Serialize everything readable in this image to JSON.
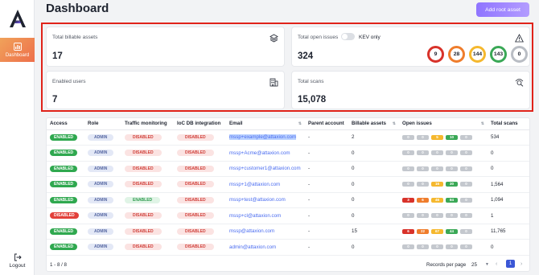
{
  "sidebar": {
    "nav_items": [
      {
        "label": "Dashboard",
        "icon": "dashboard-icon",
        "active": true
      }
    ],
    "logout_label": "Logout"
  },
  "header": {
    "title": "Dashboard",
    "add_button_label": "Add root asset"
  },
  "cards": {
    "billable": {
      "title": "Total billable assets",
      "value": "17",
      "icon": "layers-icon"
    },
    "issues": {
      "title": "Total open issues",
      "value": "324",
      "kev_label": "KEV only",
      "kev_enabled": false,
      "icon": "warning-icon",
      "rings": [
        {
          "value": "9",
          "color": "#d8322a"
        },
        {
          "value": "28",
          "color": "#ef7d2c"
        },
        {
          "value": "144",
          "color": "#f5b82e"
        },
        {
          "value": "143",
          "color": "#3aa856"
        },
        {
          "value": "0",
          "color": "#b9bdc4"
        }
      ]
    },
    "users": {
      "title": "Enabled users",
      "value": "7",
      "icon": "building-icon"
    },
    "scans": {
      "title": "Total scans",
      "value": "15,078",
      "icon": "radar-icon"
    }
  },
  "highlight_color": "#e0231a",
  "table": {
    "columns": [
      "Access",
      "Role",
      "Traffic monitoring",
      "IoC DB integration",
      "Email",
      "Parent account",
      "Billable assets",
      "Open issues",
      "Total scans"
    ],
    "issue_colors": [
      "#d8322a",
      "#ef7d2c",
      "#f5b82e",
      "#3aa856",
      "#c4c8ce"
    ],
    "rows": [
      {
        "access": "ENABLED",
        "role": "ADMIN",
        "traffic": "DISABLED",
        "ioc": "DISABLED",
        "email": "mssp+example@attaxion.com",
        "parent": "-",
        "billable": "2",
        "issues": [
          "0",
          "0",
          "5",
          "10",
          "0"
        ],
        "scans": "534"
      },
      {
        "access": "ENABLED",
        "role": "ADMIN",
        "traffic": "DISABLED",
        "ioc": "DISABLED",
        "email": "mssp+Acme@attaxion.com",
        "parent": "-",
        "billable": "0",
        "issues": [
          "0",
          "0",
          "0",
          "0",
          "0"
        ],
        "scans": "0"
      },
      {
        "access": "ENABLED",
        "role": "ADMIN",
        "traffic": "DISABLED",
        "ioc": "DISABLED",
        "email": "mssp+customer1@attaxion.com",
        "parent": "-",
        "billable": "0",
        "issues": [
          "0",
          "0",
          "0",
          "0",
          "0"
        ],
        "scans": "0"
      },
      {
        "access": "ENABLED",
        "role": "ADMIN",
        "traffic": "DISABLED",
        "ioc": "DISABLED",
        "email": "mssp+1@attaxion.com",
        "parent": "-",
        "billable": "0",
        "issues": [
          "0",
          "0",
          "16",
          "30",
          "0"
        ],
        "scans": "1,564"
      },
      {
        "access": "ENABLED",
        "role": "ADMIN",
        "traffic": "ENABLED",
        "ioc": "DISABLED",
        "email": "mssp+test@attaxion.com",
        "parent": "-",
        "billable": "0",
        "issues": [
          "3",
          "6",
          "46",
          "84",
          "0"
        ],
        "scans": "1,094"
      },
      {
        "access": "DISABLED",
        "role": "ADMIN",
        "traffic": "DISABLED",
        "ioc": "DISABLED",
        "email": "mssp+cl@attaxion.com",
        "parent": "-",
        "billable": "0",
        "issues": [
          "0",
          "0",
          "0",
          "0",
          "0"
        ],
        "scans": "1"
      },
      {
        "access": "ENABLED",
        "role": "ADMIN",
        "traffic": "DISABLED",
        "ioc": "DISABLED",
        "email": "mssp@attaxion.com",
        "parent": "-",
        "billable": "15",
        "issues": [
          "6",
          "22",
          "67",
          "44",
          "0"
        ],
        "scans": "11,765"
      },
      {
        "access": "ENABLED",
        "role": "ADMIN",
        "traffic": "DISABLED",
        "ioc": "DISABLED",
        "email": "admin@attaxion.com",
        "parent": "-",
        "billable": "0",
        "issues": [
          "0",
          "0",
          "0",
          "0",
          "0"
        ],
        "scans": "0"
      }
    ],
    "footer": {
      "count": "1 - 8 / 8",
      "records_label": "Records per page",
      "records_value": "25",
      "current_page": "1"
    }
  }
}
